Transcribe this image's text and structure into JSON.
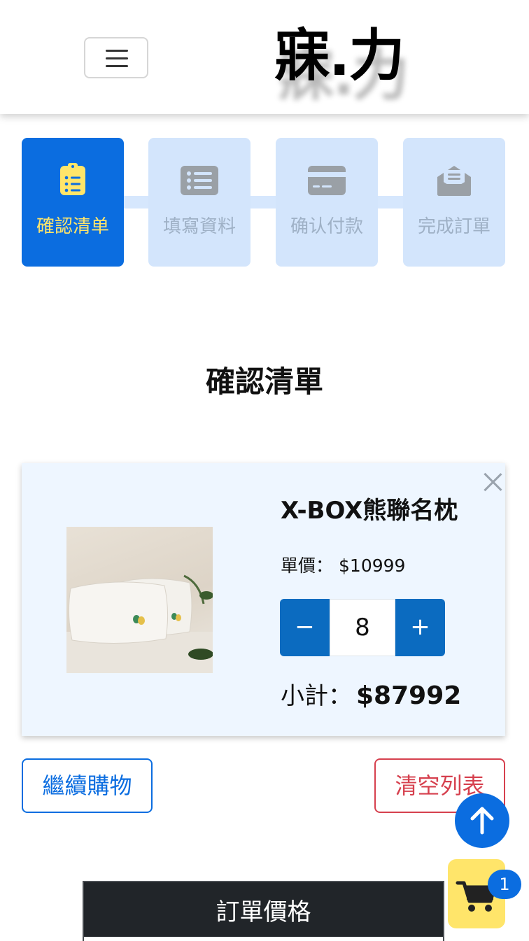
{
  "header": {
    "logo_text": "寐.力",
    "menu_icon": "hamburger-menu-icon"
  },
  "steps": [
    {
      "label": "確認清单",
      "icon": "clipboard-list-icon",
      "active": true
    },
    {
      "label": "填寫資料",
      "icon": "list-icon",
      "active": false
    },
    {
      "label": "确认付款",
      "icon": "credit-card-icon",
      "active": false
    },
    {
      "label": "完成訂單",
      "icon": "envelope-open-icon",
      "active": false
    }
  ],
  "main": {
    "title": "確認清單"
  },
  "cart_item": {
    "name": "X-BOX熊聯名枕",
    "unit_price_label": "單價：",
    "unit_price_value": "$10999",
    "quantity": "8",
    "minus_label": "−",
    "plus_label": "+",
    "subtotal_label": "小計：",
    "subtotal_value": "$87992",
    "image_alt": "pillow product photo"
  },
  "actions": {
    "continue_label": "繼續購物",
    "clear_label": "清空列表"
  },
  "floating": {
    "cart_count": "1"
  },
  "order_panel": {
    "title": "訂單價格"
  },
  "colors": {
    "primary": "#0b6de0",
    "danger": "#d6404e",
    "accent_yellow": "#ffe56a",
    "card_bg": "#eef6ff",
    "step_inactive": "#d3e5fc"
  }
}
